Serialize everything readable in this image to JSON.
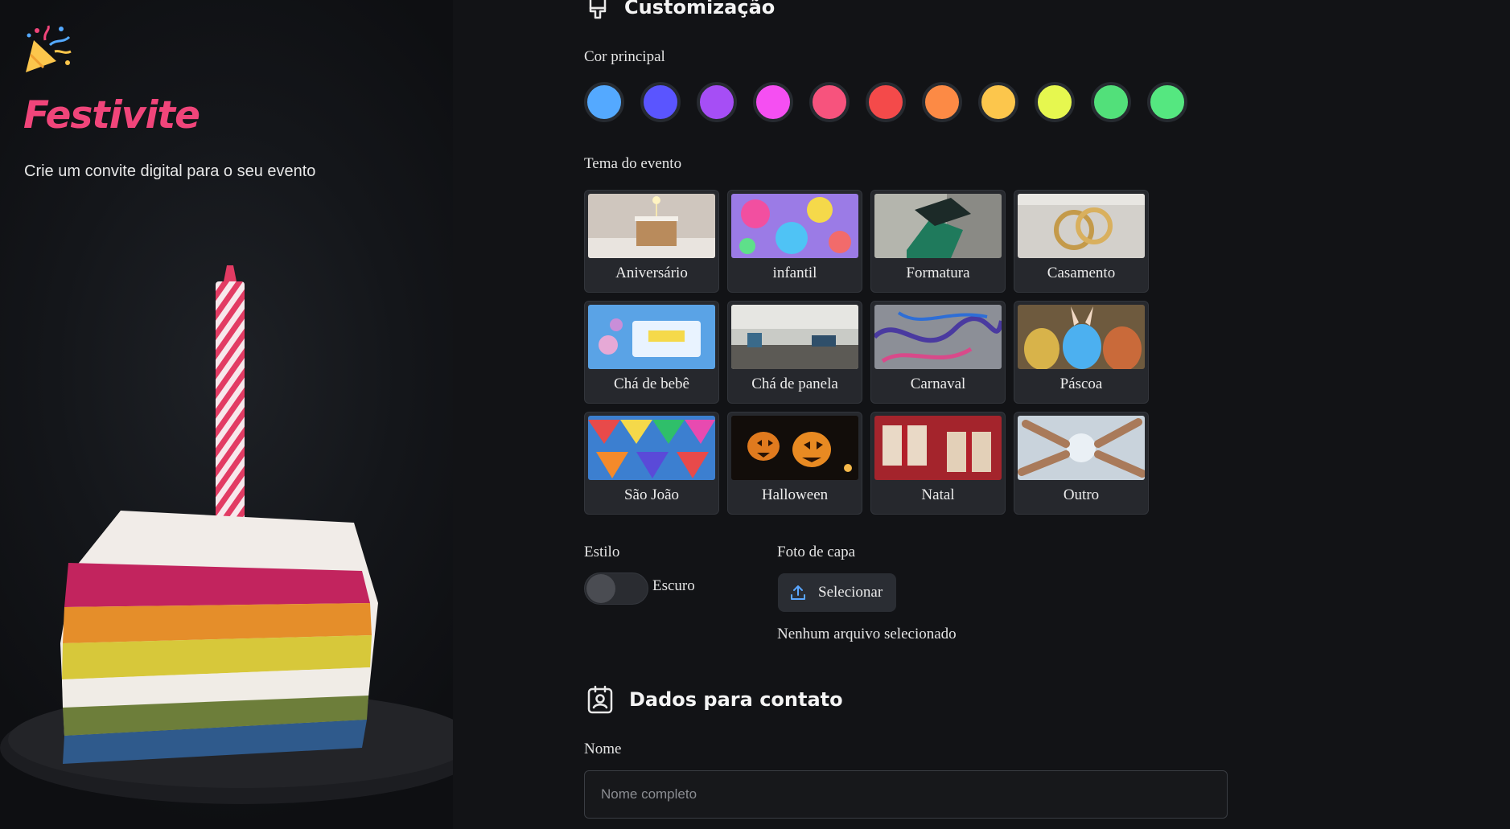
{
  "brand": {
    "name": "Festivite",
    "tagline": "Crie um convite digital para o seu evento"
  },
  "customization": {
    "title": "Customização",
    "color_label": "Cor principal",
    "colors": [
      "#54a9ff",
      "#5a55ff",
      "#a64ef5",
      "#f54ff2",
      "#f7537d",
      "#f44a4a",
      "#fc8a45",
      "#fcc64c",
      "#e6f74f",
      "#52e07a",
      "#55e780"
    ],
    "theme_label": "Tema do evento",
    "themes": [
      {
        "name": "Aniversário"
      },
      {
        "name": "infantil"
      },
      {
        "name": "Formatura"
      },
      {
        "name": "Casamento"
      },
      {
        "name": "Chá de bebê"
      },
      {
        "name": "Chá de panela"
      },
      {
        "name": "Carnaval"
      },
      {
        "name": "Páscoa"
      },
      {
        "name": "São João"
      },
      {
        "name": "Halloween"
      },
      {
        "name": "Natal"
      },
      {
        "name": "Outro"
      }
    ],
    "style_label": "Estilo",
    "style_value": "Escuro",
    "cover_label": "Foto de capa",
    "upload_button": "Selecionar",
    "no_file_text": "Nenhum arquivo selecionado"
  },
  "contact": {
    "title": "Dados para contato",
    "name_label": "Nome",
    "name_placeholder": "Nome completo"
  },
  "theme_colors": {
    "brand": "#f0457a",
    "background": "#121316",
    "card": "#26282d"
  }
}
